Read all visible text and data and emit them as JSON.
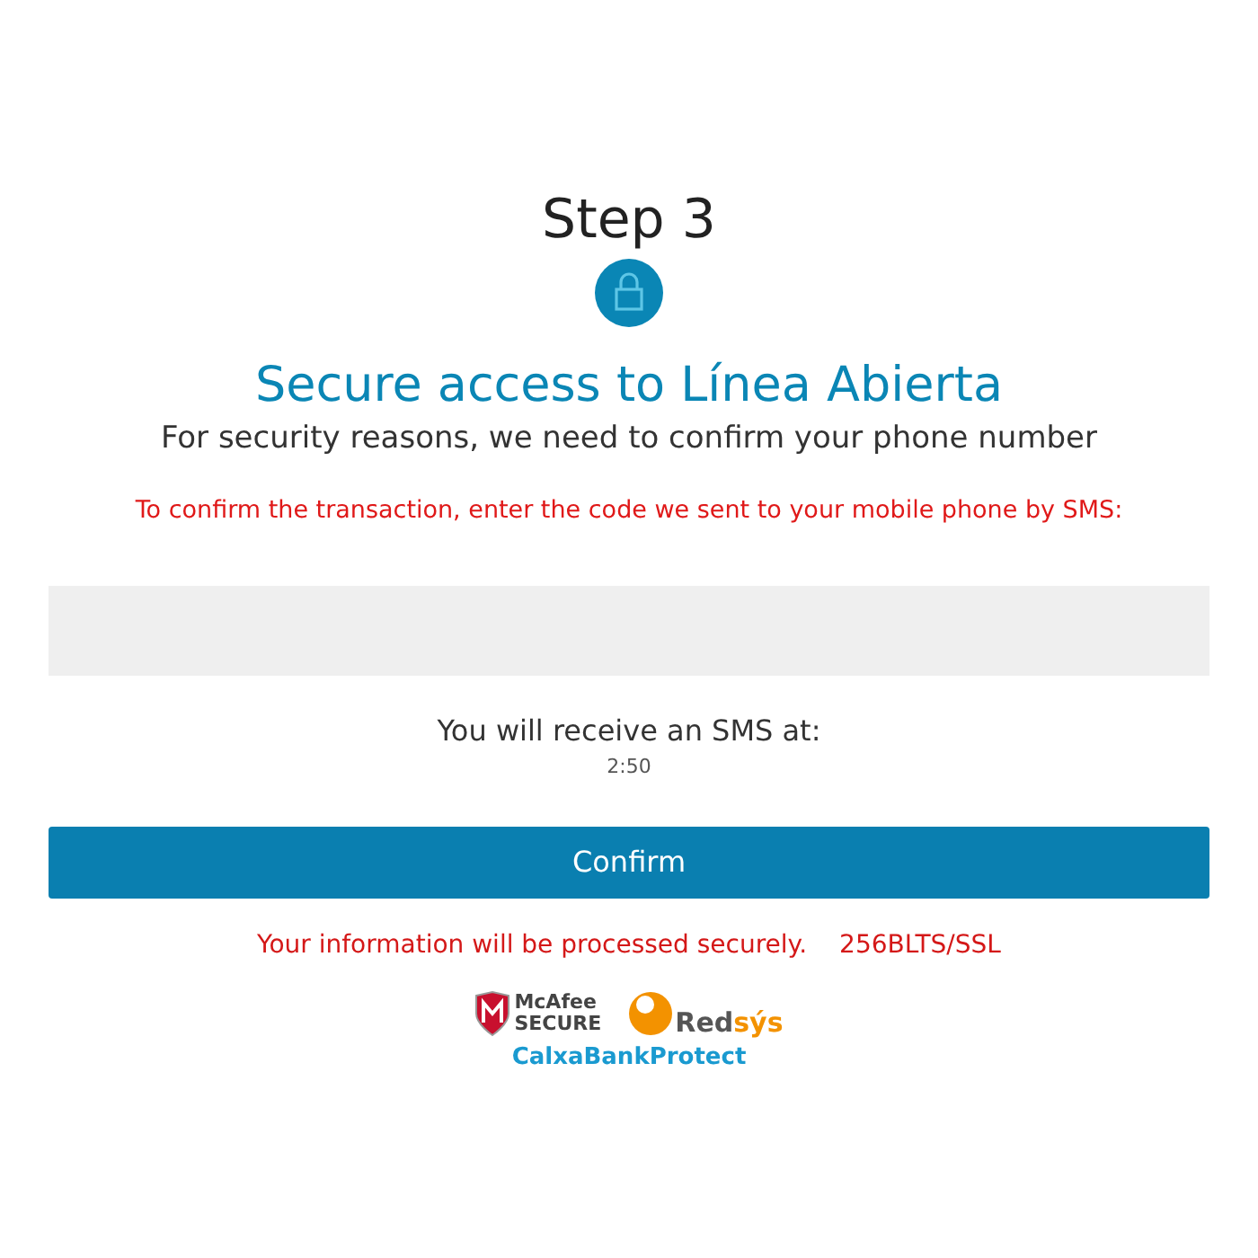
{
  "step": "Step 3",
  "title": "Secure access to Línea Abierta",
  "subtitle": "For security reasons, we need to confirm your phone number",
  "instruction": "To confirm the transaction, enter the code we sent to your mobile phone by SMS:",
  "receive_label": "You will receive an SMS at:",
  "timer": "2:50",
  "confirm_button": "Confirm",
  "security_note": [
    "Your information will be processed securely.",
    "256BLTS/SSL"
  ],
  "badges": {
    "mcafee": [
      "McAfee",
      "SECURE"
    ],
    "redsys": [
      "Red",
      "sýs"
    ],
    "protect": "CalxaBankProtect"
  }
}
